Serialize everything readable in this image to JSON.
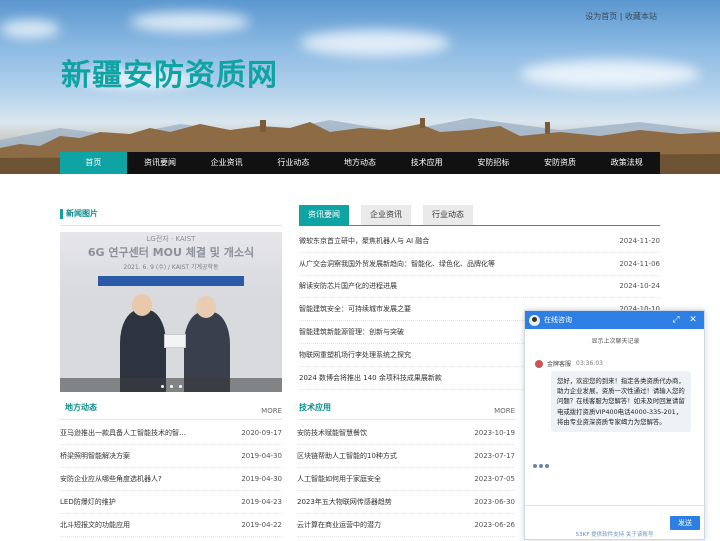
{
  "header": {
    "top_links": "设为首页 | 收藏本站",
    "site_title": "新疆安防资质网"
  },
  "nav": {
    "items": [
      "首页",
      "资讯要闻",
      "企业资讯",
      "行业动态",
      "地方动态",
      "技术应用",
      "安防招标",
      "安防资质",
      "政策法规"
    ],
    "active_index": 0
  },
  "news_pictures": {
    "title": "新闻图片",
    "sign_line1": "LG전자 · KAIST",
    "sign_line2": "6G 연구센터 MOU 체결 및 개소식",
    "sign_line3": "2021. 6. 9 (수) / KAIST 기계공학동",
    "slider_dots": 3
  },
  "tabs": {
    "items": [
      "资讯要闻",
      "企业资讯",
      "行业动态"
    ],
    "active_index": 0
  },
  "main_news": [
    {
      "title": "微软东京首立研中，聚焦机器人与 AI 融合",
      "date": "2024-11-20"
    },
    {
      "title": "从广交会洞察我国外贸发展新趋向：智能化、绿色化、品牌化等",
      "date": "2024-11-06"
    },
    {
      "title": "解读安防芯片国产化的进程进展",
      "date": "2024-10-24"
    },
    {
      "title": "智能建筑安全：可持续城市发展之要",
      "date": "2024-10-10"
    },
    {
      "title": "智能建筑新能源管理：创新与突破",
      "date": ""
    },
    {
      "title": "物联网重塑机场行李处理系统之探究",
      "date": ""
    },
    {
      "title": "2024 数博会将推出 140 余项科技成果展新款",
      "date": ""
    }
  ],
  "local_news": {
    "title": "地方动态",
    "more": "MORE",
    "items": [
      {
        "title": "亚马逊推出一款具备人工智能技术的智…",
        "date": "2020-09-17"
      },
      {
        "title": "桥梁照明智能解决方案",
        "date": "2019-04-30"
      },
      {
        "title": "安防企业应从哪些角度选机器人?",
        "date": "2019-04-30"
      },
      {
        "title": "LED防爆灯的维护",
        "date": "2019-04-23"
      },
      {
        "title": "北斗短报文的功能应用",
        "date": "2019-04-22"
      }
    ]
  },
  "tech_news": {
    "title": "技术应用",
    "more": "MORE",
    "items": [
      {
        "title": "安防技术赋能智慧餐饮",
        "date": "2023-10-19"
      },
      {
        "title": "区块链帮助人工智能的10种方式",
        "date": "2023-07-17"
      },
      {
        "title": "人工智能如何用于家庭安全",
        "date": "2023-07-05"
      },
      {
        "title": "2023年五大物联网传感器趋势",
        "date": "2023-06-30"
      },
      {
        "title": "云计算在商业运营中的潜力",
        "date": "2023-06-26"
      }
    ]
  },
  "chat": {
    "title": "在线咨询",
    "history_label": "显示上次聊天记录",
    "agent_name": "金牌客服",
    "agent_time": "03:36:03",
    "message": "您好，欢迎您的到来！指定各类资质代办商，助力企业发展，资质一次性通过！请输入您的问题？在线客服为您解答！如未及时回复请留电或拨打资质VIP400电话4000-335-201，将由专业资深资质专家竭力为您解答。",
    "send_label": "发送",
    "powered_by": "53KF 提供软件支持  关于该账号",
    "header_color": "#2d7fe3"
  },
  "colors": {
    "accent": "#0fa3a3",
    "nav_bg": "#111111"
  }
}
